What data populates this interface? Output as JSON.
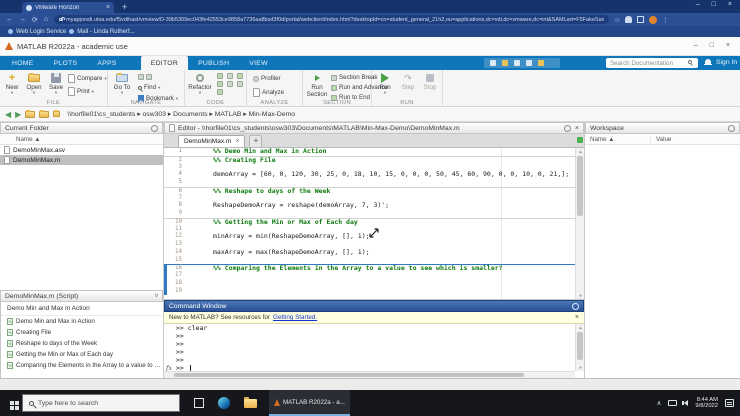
{
  "browser": {
    "tab_title": "VMware Horizon",
    "url": "myappsvdi.utsa.edu/f5vdihast/vmview/D-39b5309ec043fe42553ce9858a7736aa8bsd3f0d/portal/webclient/index.html?desktopId=cn=student_general_21h2,ou=applications,dc=vdi,dc=vmware,dc=int&SAMLart=F5FakeSamWtBmck=0-M...",
    "bookmarks": [
      {
        "label": "Web Login Service"
      },
      {
        "label": "Mail - Linda Rutherf..."
      }
    ]
  },
  "matlab": {
    "title": "MATLAB R2022a - academic use",
    "ribbon_tabs": [
      {
        "label": "HOME",
        "cls": ""
      },
      {
        "label": "PLOTS",
        "cls": ""
      },
      {
        "label": "APPS",
        "cls": ""
      },
      {
        "label": "EDITOR",
        "cls": "active"
      },
      {
        "label": "PUBLISH",
        "cls": ""
      },
      {
        "label": "VIEW",
        "cls": ""
      }
    ],
    "search_placeholder": "Search Documentation",
    "sign_in": "Sign In",
    "path": "\\\\horfile01\\cs_students  ▸  osw303  ▸  Documents  ▸  MATLAB  ▸  Min-Max-Demo",
    "toolstrip": {
      "file": {
        "label": "FILE",
        "new": "New",
        "open": "Open",
        "save": "Save",
        "compare": "Compare",
        "print": "Print"
      },
      "navigate": {
        "label": "NAVIGATE",
        "goto": "Go To",
        "find": "Find",
        "bookmark": "Bookmark"
      },
      "code": {
        "label": "CODE",
        "refactor": "Refactor"
      },
      "analyze": {
        "label": "ANALYZE",
        "profiler": "Profiler",
        "analyze": "Analyze"
      },
      "section": {
        "label": "SECTION",
        "run_section": "Run Section",
        "section_break": "Section Break",
        "run_advance": "Run and Advance",
        "run_to_end": "Run to End"
      },
      "run": {
        "label": "RUN",
        "run": "Run",
        "step": "Step",
        "stop": "Stop"
      }
    }
  },
  "current_folder": {
    "title": "Current Folder",
    "name_header": "Name ▲",
    "files": [
      {
        "name": "DemoMinMax.asv",
        "cls": ""
      },
      {
        "name": "DemoMinMax.m",
        "cls": "selected"
      }
    ],
    "details": {
      "header": "DemoMinMax.m  (Script)",
      "title": "Demo Min and Max in Action",
      "sections": [
        {
          "label": "Demo Min and Max in Action"
        },
        {
          "label": "Creating File"
        },
        {
          "label": "Reshape to days of the Week"
        },
        {
          "label": "Getting the Min or Max of Each day"
        },
        {
          "label": "Comparing the Elements in the Array to a value to see ..."
        }
      ]
    }
  },
  "editor": {
    "header": "Editor - \\\\horfile01\\cs_students\\osw303\\Documents\\MATLAB\\Min-Max-Demo\\DemoMinMax.m",
    "tab": "DemoMinMax.m",
    "lines": [
      {
        "num": 1,
        "text": "%% Demo Min and Max in Action",
        "cls": "comment"
      },
      {
        "num": 2,
        "text": "%% Creating File",
        "cls": "comment divider"
      },
      {
        "num": 3,
        "text": "",
        "cls": ""
      },
      {
        "num": 4,
        "text": "demoArray = [60, 0, 120, 30, 25, 0, 18, 10, 15, 0, 0, 0, 50, 45, 60, 90, 0, 0, 10, 0, 21,];",
        "cls": ""
      },
      {
        "num": 5,
        "text": "",
        "cls": ""
      },
      {
        "num": 6,
        "text": "%% Reshape to days of the Week",
        "cls": "comment divider"
      },
      {
        "num": 7,
        "text": "",
        "cls": ""
      },
      {
        "num": 8,
        "text": "ReshapeDemoArray = reshape(demoArray, 7, 3)';",
        "cls": ""
      },
      {
        "num": 9,
        "text": "",
        "cls": ""
      },
      {
        "num": 10,
        "text": "%% Getting the Min or Max of Each day",
        "cls": "comment divider"
      },
      {
        "num": 11,
        "text": "",
        "cls": ""
      },
      {
        "num": 12,
        "text": "minArray = min(ReshapeDemoArray, [], 1);",
        "cls": ""
      },
      {
        "num": 13,
        "text": "",
        "cls": ""
      },
      {
        "num": 14,
        "text": "maxArray = max(ReshapeDemoArray, [], 1);",
        "cls": ""
      },
      {
        "num": 15,
        "text": "",
        "cls": ""
      },
      {
        "num": 16,
        "text": "%% Comparing the Elements in the Array to a value to see which is smaller?",
        "cls": "comment bluediv current"
      },
      {
        "num": 17,
        "text": "",
        "cls": "current"
      },
      {
        "num": 18,
        "text": "",
        "cls": "current"
      },
      {
        "num": 19,
        "text": "",
        "cls": "current"
      }
    ]
  },
  "command_window": {
    "title": "Command Window",
    "banner_text": "New to MATLAB? See resources for",
    "banner_link": "Getting Started.",
    "history": [
      {
        "t": ">> clear"
      },
      {
        "t": ">>"
      },
      {
        "t": ">>"
      },
      {
        "t": ">>"
      },
      {
        "t": ">>"
      }
    ],
    "prompt": ">>",
    "fx": "fx"
  },
  "workspace": {
    "title": "Workspace",
    "col_name": "Name ▲",
    "col_value": "Value"
  },
  "taskbar": {
    "search_placeholder": "Type here to search",
    "matlab_button": "MATLAB R2022a - a...",
    "time": "8:44 AM",
    "date": "9/8/2022"
  },
  "glyphs": {
    "back": "←",
    "forward": "→",
    "reload": "⟳",
    "home": "⌂",
    "minimize": "–",
    "maximize": "□",
    "close": "×",
    "newtab": "+",
    "caret": "▾",
    "kebab": "⋮",
    "star": "☆",
    "chevron_up": "∧",
    "plus": "+",
    "x": "×",
    "step": "↷",
    "up": "▲",
    "down": "▼",
    "left": "◀",
    "right": "▶"
  }
}
